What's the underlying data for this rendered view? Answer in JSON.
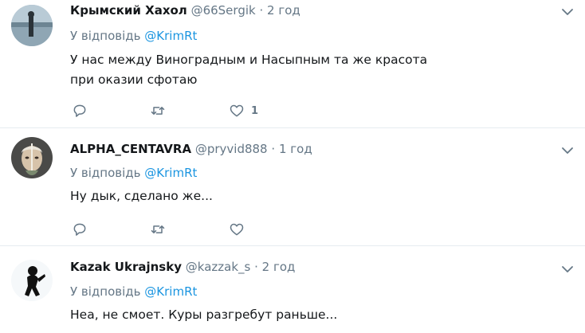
{
  "tweets": [
    {
      "name": "Крымский Хахол",
      "handle": "@66Sergik",
      "dot": "·",
      "time": "2 год",
      "reply_prefix": "У відповідь",
      "reply_to": "@KrimRt",
      "text_lines": [
        "У нас между Виноградным и Насыпным та же красота",
        "при оказии сфотаю"
      ],
      "like_count": "1",
      "avatar": "lake-silhouette-photo"
    },
    {
      "name": "ALPHA_CENTAVRA",
      "handle": "@pryvid888",
      "dot": "·",
      "time": "1 год",
      "reply_prefix": "У відповідь",
      "reply_to": "@KrimRt",
      "text_lines": [
        "Ну дык, сделано же..."
      ],
      "like_count": "",
      "avatar": "face-portrait"
    },
    {
      "name": "Kazak Ukrajnsky",
      "handle": "@kazzak_s",
      "dot": "·",
      "time": "2 год",
      "reply_prefix": "У відповідь",
      "reply_to": "@KrimRt",
      "text_lines": [
        "Неа, не смоет. Куры разгребут раньше..."
      ],
      "like_count": "",
      "avatar": "cossack-silhouette"
    }
  ],
  "colors": {
    "link": "#1b95e0",
    "secondary": "#657786",
    "separator": "#e6ecf0"
  }
}
